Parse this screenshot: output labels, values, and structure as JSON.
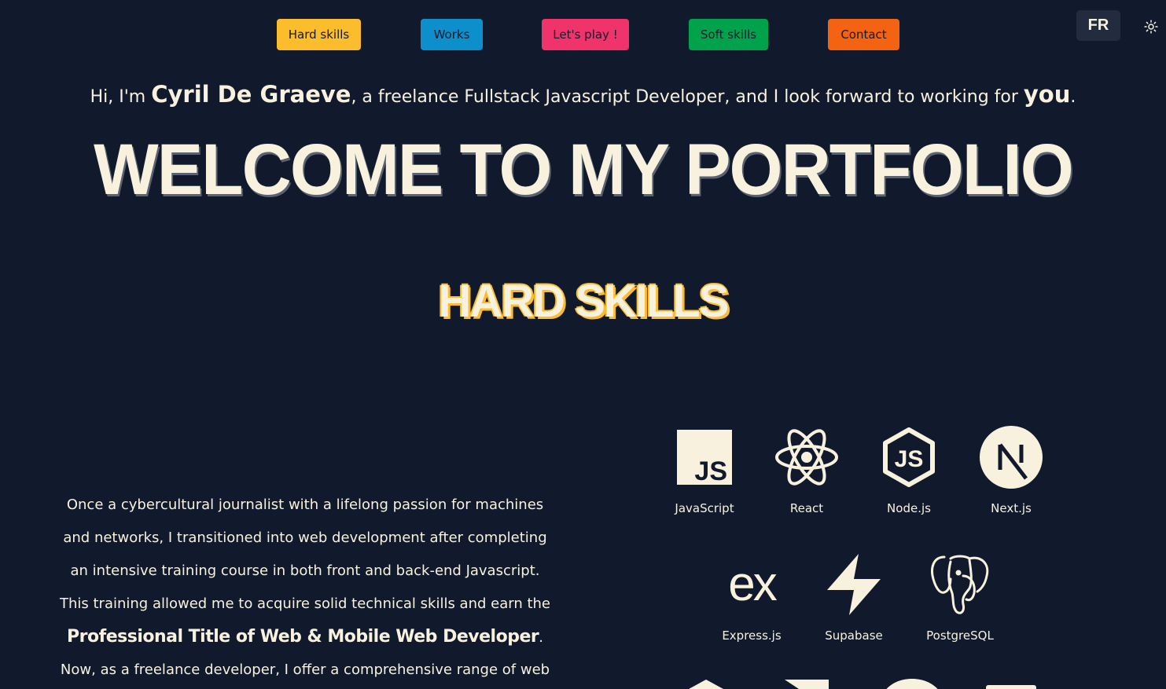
{
  "nav": {
    "items": [
      {
        "label": "Hard skills",
        "color": "#fbbd2c"
      },
      {
        "label": "Works",
        "color": "#0d8fcb"
      },
      {
        "label": "Let's play !",
        "color": "#f0336a"
      },
      {
        "label": "Soft skills",
        "color": "#00a34c"
      },
      {
        "label": "Contact",
        "color": "#f36311"
      }
    ],
    "language": "FR",
    "theme_icon": "sun-icon"
  },
  "intro": {
    "prefix": "Hi, I'm ",
    "name": "Cyril De Graeve",
    "middle": ", a freelance Fullstack Javascript Developer, and I look forward to working for ",
    "you": "you",
    "suffix": "."
  },
  "title": "WELCOME TO MY PORTFOLIO",
  "hard_skills": {
    "title": "HARD SKILLS",
    "accent": "#fbbd2c",
    "bio": {
      "line1": "Once a cybercultural journalist with a lifelong passion for machines",
      "line2": "and networks, I transitioned into web development after completing",
      "line3": "an intensive training course in both front and back-end Javascript.",
      "line4": "This training allowed me to acquire solid technical skills and earn the",
      "strong": "Professional Title of Web & Mobile Web Developer",
      "strong_suffix": ".",
      "line6": "Now, as a freelance developer, I offer a comprehensive range of web"
    },
    "skills": [
      {
        "name": "JavaScript",
        "icon": "javascript-icon"
      },
      {
        "name": "React",
        "icon": "react-icon"
      },
      {
        "name": "Node.js",
        "icon": "nodejs-icon"
      },
      {
        "name": "Next.js",
        "icon": "nextjs-icon"
      },
      {
        "name": "Express.js",
        "icon": "expressjs-icon"
      },
      {
        "name": "Supabase",
        "icon": "supabase-icon"
      },
      {
        "name": "PostgreSQL",
        "icon": "postgresql-icon"
      }
    ]
  }
}
